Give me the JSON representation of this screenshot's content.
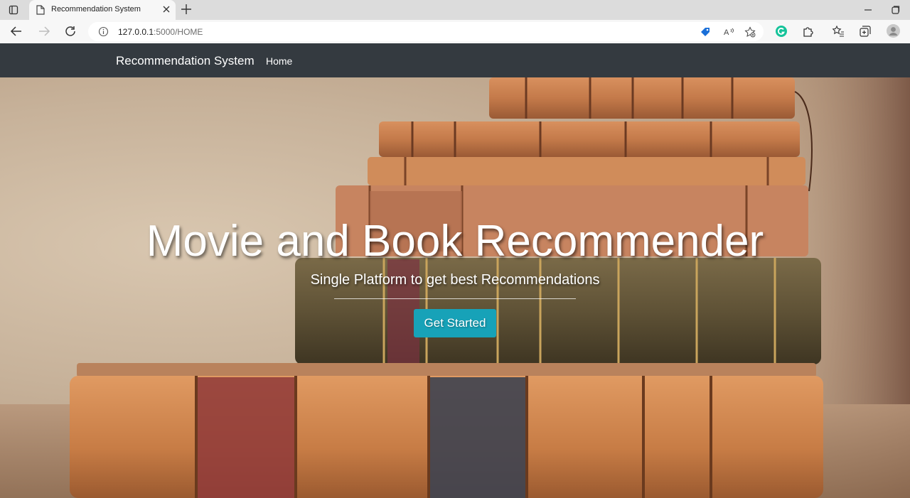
{
  "browser": {
    "tab_title": "Recommendation System",
    "url_host": "127.0.0.1",
    "url_rest": ":5000/HOME",
    "icons": [
      "window-icon",
      "page-icon",
      "close-icon",
      "plus-icon",
      "back-icon",
      "forward-icon",
      "reload-icon",
      "info-icon",
      "tag-icon",
      "read-aloud-icon",
      "favorite-add-icon",
      "grammarly-icon",
      "extensions-icon",
      "favorites-icon",
      "collections-icon",
      "profile-icon",
      "minimize-icon",
      "maximize-icon"
    ]
  },
  "navbar": {
    "brand": "Recommendation System",
    "home_link": "Home",
    "background": "#343a40"
  },
  "hero": {
    "title": "Movie and Book Recommender",
    "subtitle": "Single Platform to get best Recommendations",
    "cta_label": "Get Started",
    "cta_color": "#17a2b8"
  }
}
